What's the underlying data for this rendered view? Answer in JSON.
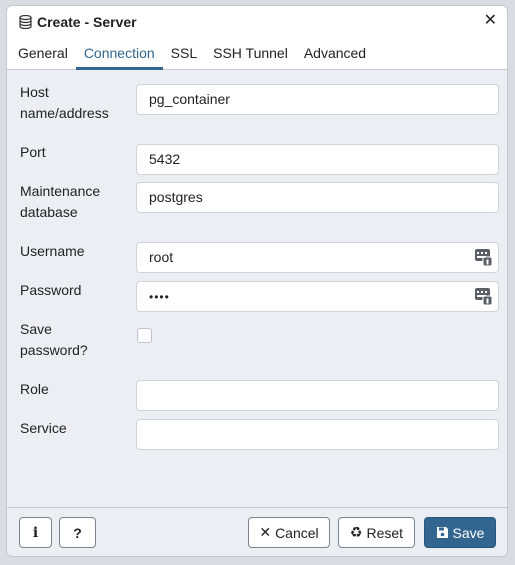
{
  "dialog": {
    "title": "Create - Server",
    "close_symbol": "✕"
  },
  "tabs": [
    {
      "label": "General",
      "active": false
    },
    {
      "label": "Connection",
      "active": true
    },
    {
      "label": "SSL",
      "active": false
    },
    {
      "label": "SSH Tunnel",
      "active": false
    },
    {
      "label": "Advanced",
      "active": false
    }
  ],
  "form": {
    "host": {
      "label_1": "Host",
      "label_2": "name/address",
      "value": "pg_container"
    },
    "port": {
      "label": "Port",
      "value": "5432"
    },
    "maintenance_db": {
      "label_1": "Maintenance",
      "label_2": "database",
      "value": "postgres"
    },
    "username": {
      "label": "Username",
      "value": "root"
    },
    "password": {
      "label": "Password",
      "value": "••••"
    },
    "save_password": {
      "label_1": "Save",
      "label_2": "password?",
      "checked": false
    },
    "role": {
      "label": "Role",
      "value": ""
    },
    "service": {
      "label": "Service",
      "value": ""
    }
  },
  "footer": {
    "info_label": "i",
    "help_label": "?",
    "cancel_label": "Cancel",
    "reset_label": "Reset",
    "save_label": "Save",
    "cancel_icon": "✕",
    "reset_icon": "♻"
  },
  "colors": {
    "accent": "#326690",
    "background": "#ebeef3"
  }
}
